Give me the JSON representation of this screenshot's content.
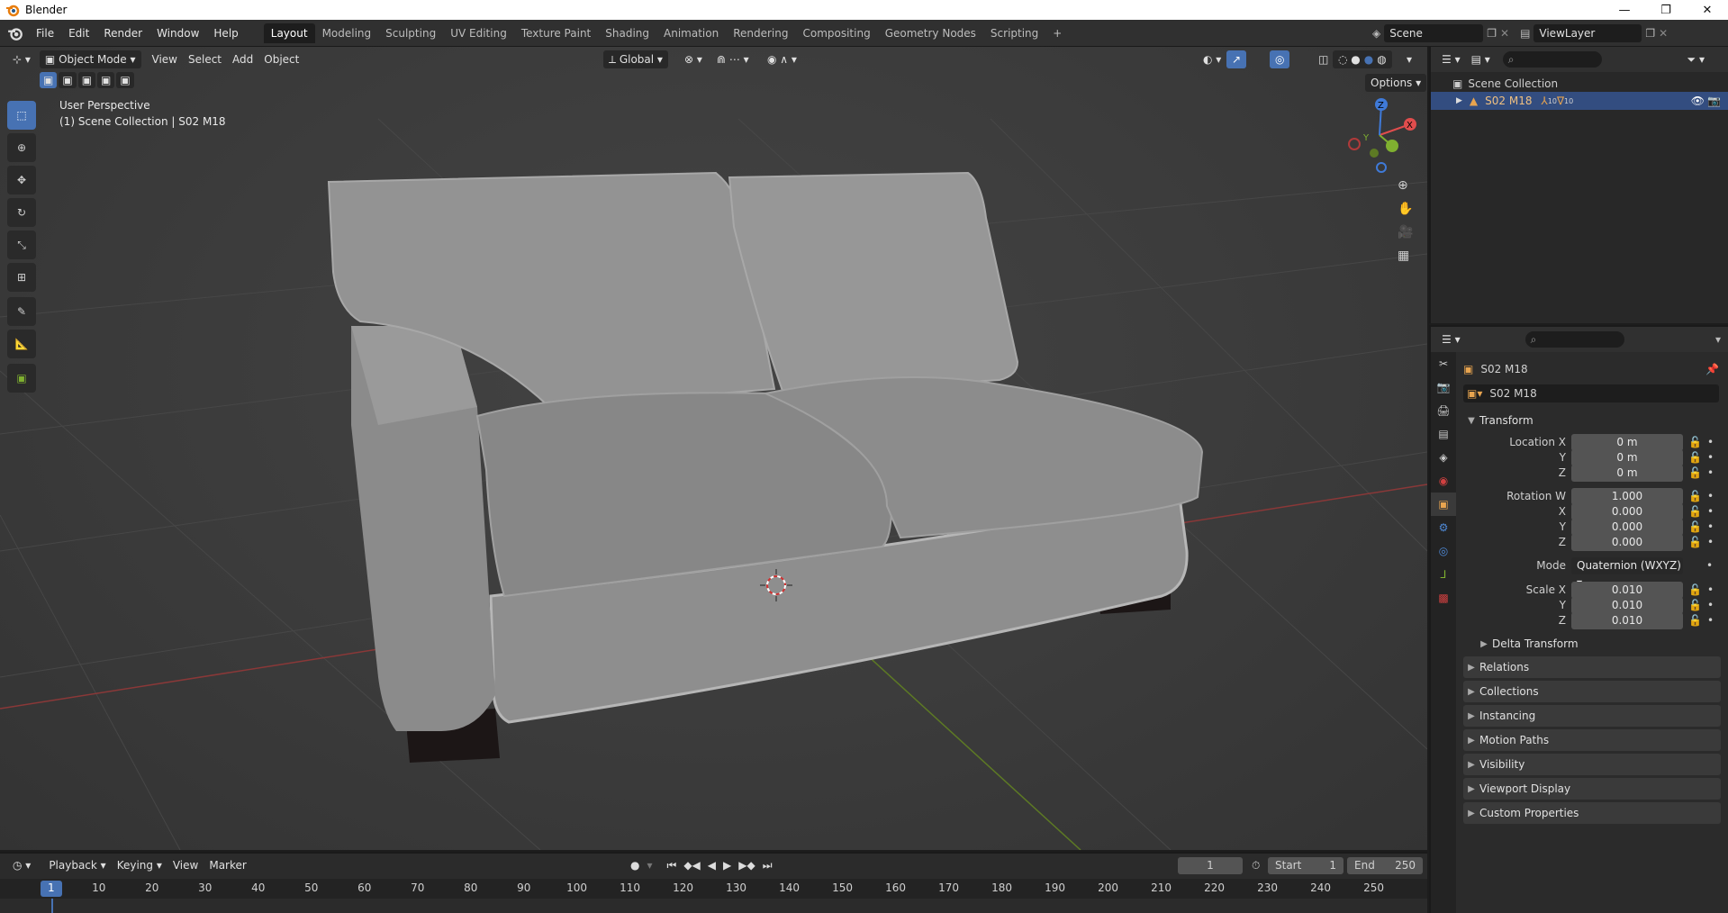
{
  "window": {
    "title": "Blender",
    "controls": [
      "—",
      "❐",
      "✕"
    ]
  },
  "menu": [
    "File",
    "Edit",
    "Render",
    "Window",
    "Help"
  ],
  "workspaces": [
    "Layout",
    "Modeling",
    "Sculpting",
    "UV Editing",
    "Texture Paint",
    "Shading",
    "Animation",
    "Rendering",
    "Compositing",
    "Geometry Nodes",
    "Scripting"
  ],
  "active_workspace": "Layout",
  "scene": "Scene",
  "view_layer": "ViewLayer",
  "viewport": {
    "mode": "Object Mode",
    "menus": [
      "View",
      "Select",
      "Add",
      "Object"
    ],
    "orientation": "Global",
    "options_label": "Options",
    "overlay_line1": "User Perspective",
    "overlay_line2": "(1) Scene Collection | S02 M18",
    "gizmo": {
      "x": "X",
      "y": "Y",
      "z": "Z"
    }
  },
  "outliner": {
    "root": "Scene Collection",
    "items": [
      {
        "name": "S02 M18",
        "badge1": "10",
        "badge2": "10"
      }
    ]
  },
  "properties": {
    "object_name": "S02 M18",
    "data_name": "S02 M18",
    "transform_label": "Transform",
    "location": {
      "label": "Location X",
      "x": "0 m",
      "y": "0 m",
      "z": "0 m"
    },
    "rotation": {
      "label": "Rotation W",
      "w": "1.000",
      "x": "0.000",
      "y": "0.000",
      "z": "0.000"
    },
    "mode_label": "Mode",
    "mode_value": "Quaternion (WXYZ)",
    "scale": {
      "label": "Scale X",
      "x": "0.010",
      "y": "0.010",
      "z": "0.010"
    },
    "axis_y": "Y",
    "axis_z": "Z",
    "axis_x": "X",
    "delta": "Delta Transform",
    "panels": [
      "Relations",
      "Collections",
      "Instancing",
      "Motion Paths",
      "Visibility",
      "Viewport Display",
      "Custom Properties"
    ]
  },
  "timeline": {
    "menus": [
      "Playback",
      "Keying",
      "View",
      "Marker"
    ],
    "current_frame": "1",
    "start_label": "Start",
    "start": "1",
    "end_label": "End",
    "end": "250",
    "ticks": [
      "1",
      "10",
      "20",
      "30",
      "40",
      "50",
      "60",
      "70",
      "80",
      "90",
      "100",
      "110",
      "120",
      "130",
      "140",
      "150",
      "160",
      "170",
      "180",
      "190",
      "200",
      "210",
      "220",
      "230",
      "240",
      "250"
    ]
  },
  "colors": {
    "accent": "#4772b3",
    "x_axis": "#e04d4d",
    "y_axis": "#7fb030",
    "z_axis": "#3f7ad8"
  }
}
